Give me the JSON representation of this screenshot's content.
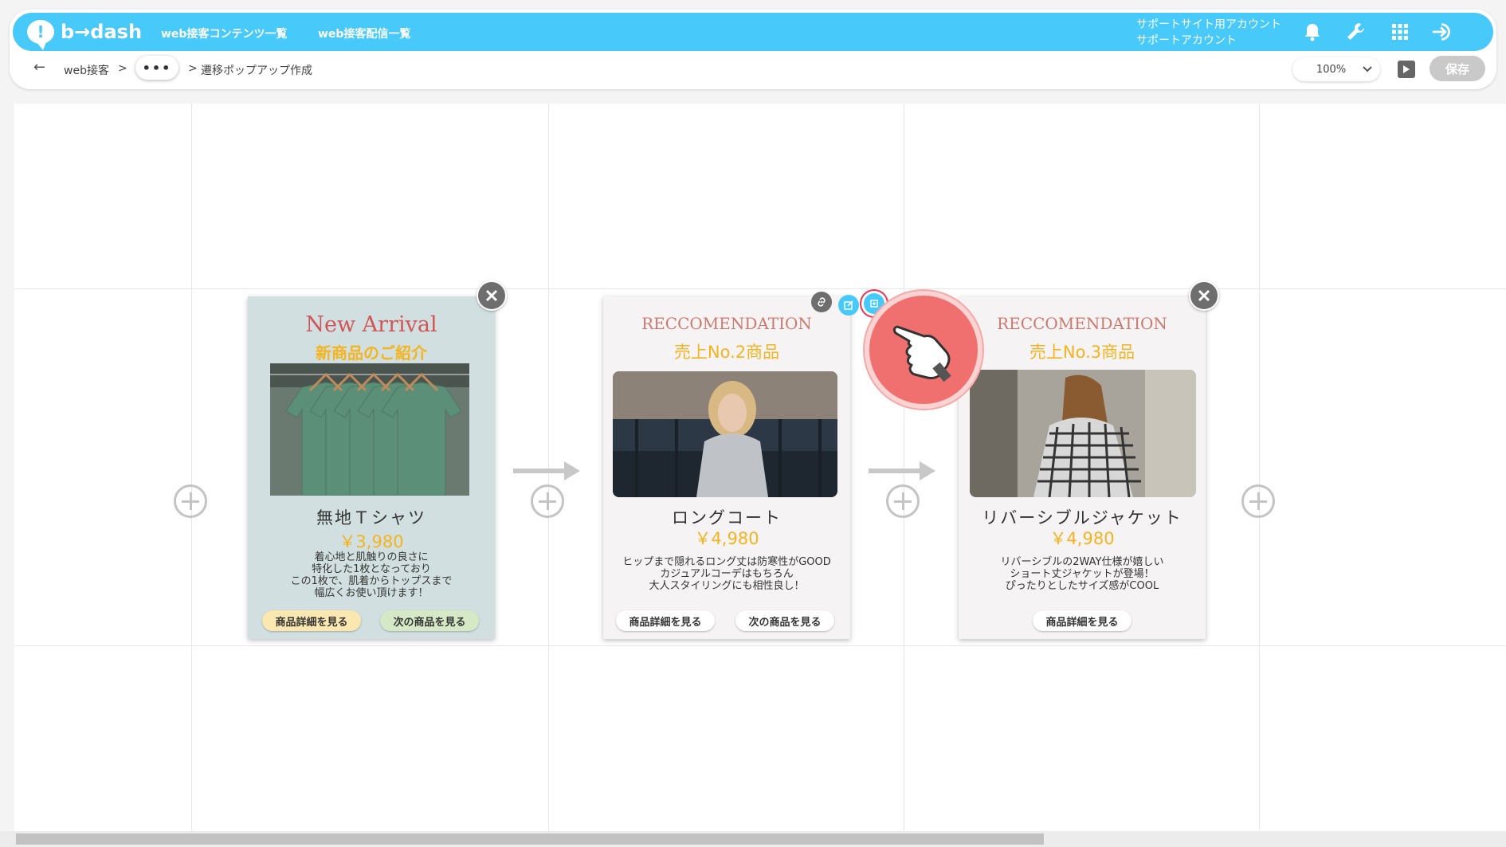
{
  "header": {
    "logo_text": "b→dash",
    "nav": [
      "web接客コンテンツ一覧",
      "web接客配信一覧"
    ],
    "account_line1": "サポートサイト用アカウント",
    "account_line2": "サポートアカウント",
    "icons": [
      "bell-icon",
      "wrench-icon",
      "grid-icon",
      "logout-icon"
    ]
  },
  "breadcrumb": {
    "back": "←",
    "root": "web接客",
    "sep": ">",
    "ellipsis": "•••",
    "current": "遷移ポップアップ作成"
  },
  "toolbar": {
    "zoom": "100%",
    "save_label": "保存"
  },
  "cards": [
    {
      "title": "New Arrival",
      "subtitle": "新商品のご紹介",
      "name": "無地Ｔシャツ",
      "price": "￥3,980",
      "description": "着心地と肌触りの良さに\n特化した1枚となっており\nこの1枚で、肌着からトップスまで\n幅広くお使い頂けます！",
      "buttons": [
        "商品詳細を見る",
        "次の商品を見る"
      ]
    },
    {
      "title": "RECCOMENDATION",
      "subtitle": "売上No.2商品",
      "name": "ロングコート",
      "price": "￥4,980",
      "description": "ヒップまで隠れるロング丈は防寒性がGOOD\nカジュアルコーデはもちろん\n大人スタイリングにも相性良し！",
      "buttons": [
        "商品詳細を見る",
        "次の商品を見る"
      ]
    },
    {
      "title": "RECCOMENDATION",
      "subtitle": "売上No.3商品",
      "name": "リバーシブルジャケット",
      "price": "￥4,980",
      "description": "リバーシブルの2WAY仕様が嬉しい\nショート丈ジャケットが登場！\nぴったりとしたサイズ感がCOOL",
      "buttons": [
        "商品詳細を見る"
      ]
    }
  ],
  "colors": {
    "brand_blue": "#47c9fa",
    "accent_yellow": "#f3b41f",
    "title_red": "#d05656",
    "pointer_red": "#f07070"
  }
}
